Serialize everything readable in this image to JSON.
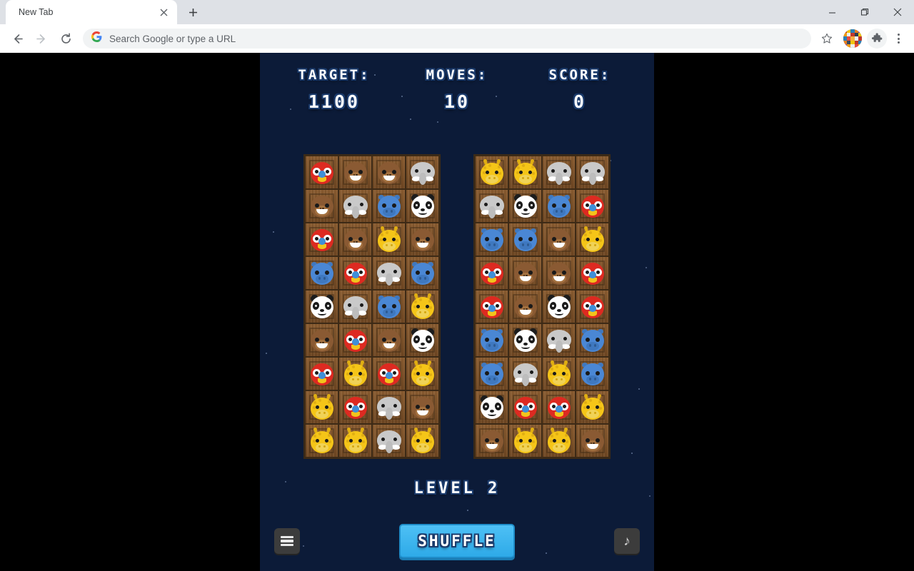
{
  "browser": {
    "tab": {
      "title": "New Tab",
      "close_icon": "close-icon"
    },
    "new_tab_icon": "plus-icon",
    "window_controls": {
      "minimize": "minimize-icon",
      "maximize": "maximize-icon",
      "close": "close-icon"
    },
    "nav": {
      "back_icon": "back-arrow-icon",
      "forward_icon": "forward-arrow-icon",
      "reload_icon": "reload-icon"
    },
    "omnibox": {
      "placeholder": "Search Google or type a URL",
      "value": "",
      "google_icon": "google-g-icon"
    },
    "actions": {
      "bookmark_icon": "star-icon",
      "profile_icon": "avatar-icon",
      "extensions_icon": "puzzle-piece-icon",
      "menu_icon": "three-dots-menu-icon"
    }
  },
  "game": {
    "background_color": "#0c1b38",
    "hud": [
      {
        "label": "TARGET:",
        "value": "1100",
        "name": "target"
      },
      {
        "label": "MOVES:",
        "value": "10",
        "name": "moves"
      },
      {
        "label": "SCORE:",
        "value": "0",
        "name": "score"
      }
    ],
    "level_text": "LEVEL 2",
    "boards": [
      {
        "name": "left-board",
        "columns": 4,
        "rows": 9,
        "tiles": [
          [
            "parrot",
            "monkey",
            "monkey",
            "elephant"
          ],
          [
            "monkey",
            "elephant",
            "hippo",
            "panda"
          ],
          [
            "parrot",
            "monkey",
            "giraffe",
            "monkey"
          ],
          [
            "hippo",
            "parrot",
            "elephant",
            "hippo"
          ],
          [
            "panda",
            "elephant",
            "hippo",
            "giraffe"
          ],
          [
            "monkey",
            "parrot",
            "monkey",
            "panda"
          ],
          [
            "parrot",
            "giraffe",
            "parrot",
            "giraffe"
          ],
          [
            "giraffe",
            "parrot",
            "elephant",
            "monkey"
          ],
          [
            "giraffe",
            "giraffe",
            "elephant",
            "giraffe"
          ]
        ]
      },
      {
        "name": "right-board",
        "columns": 4,
        "rows": 9,
        "tiles": [
          [
            "giraffe",
            "giraffe",
            "elephant",
            "elephant"
          ],
          [
            "elephant",
            "panda",
            "hippo",
            "parrot"
          ],
          [
            "hippo",
            "hippo",
            "monkey",
            "giraffe"
          ],
          [
            "parrot",
            "monkey",
            "monkey",
            "parrot"
          ],
          [
            "parrot",
            "monkey",
            "panda",
            "parrot"
          ],
          [
            "hippo",
            "panda",
            "elephant",
            "hippo"
          ],
          [
            "hippo",
            "elephant",
            "giraffe",
            "hippo"
          ],
          [
            "panda",
            "parrot",
            "parrot",
            "giraffe"
          ],
          [
            "monkey",
            "giraffe",
            "giraffe",
            "monkey"
          ]
        ]
      }
    ],
    "controls": {
      "menu_button": {
        "icon": "hamburger-menu-icon",
        "label": ""
      },
      "shuffle_button": {
        "label": "SHUFFLE",
        "color": "#2eaae8"
      },
      "sound_button": {
        "icon": "music-note-icon",
        "label": ""
      }
    },
    "animal_colors": {
      "parrot": "#dd2a21",
      "monkey": "#8a5a33",
      "elephant": "#c9c9c9",
      "hippo": "#4a87d4",
      "panda": "#ffffff",
      "giraffe": "#f5c518"
    }
  }
}
